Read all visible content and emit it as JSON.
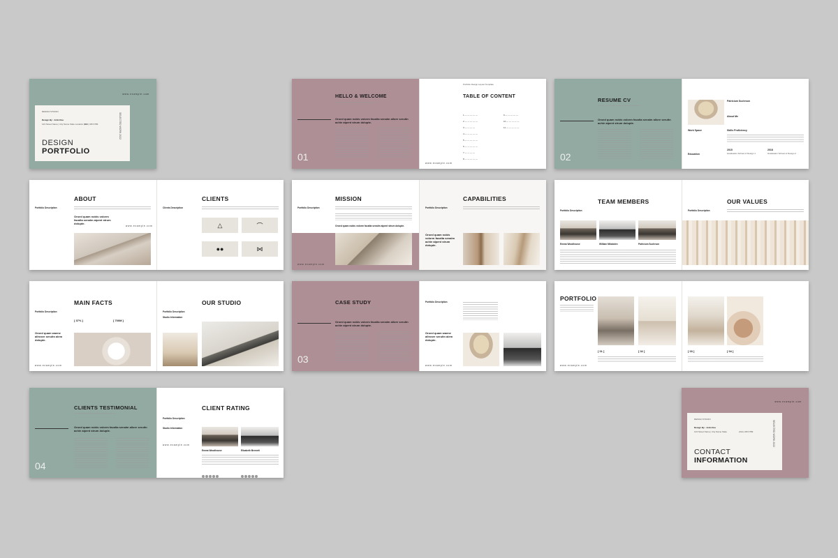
{
  "cover": {
    "studio": "DESIGN STUDIO",
    "url": "www.example.com",
    "design_by": "Design By : John Doe",
    "address": "123 Street Name | City Name State Location 012",
    "phone": "(012) 345 6789",
    "title_line1": "DESIGN",
    "title_line2": "PORTFOLIO",
    "side_text": "SELECTED WORK 2022"
  },
  "hello": {
    "num": "01",
    "title": "HELLO & WELCOME",
    "intro": "Oroed quam nobis volorm facalta senalm allore seruitn achie aipent strum dolupte."
  },
  "toc": {
    "header": "Portfolio Design Layout Template",
    "title": "TABLE OF CONTENT",
    "url": "www.example.com",
    "items": [
      "1",
      "2",
      "3",
      "4",
      "5",
      "6",
      "7",
      "8",
      "9",
      "10",
      "11"
    ]
  },
  "resume": {
    "num": "02",
    "title": "RESUME CV",
    "intro": "Oroed quam nobis volorm facalta senalm allore seruitn achie aipent strum dolupte.",
    "name": "Patricium Suchrson",
    "about": "About Me",
    "skills": "Skills Proficiency",
    "work_space": "Work Space",
    "education": "Education",
    "y1": "2015",
    "y2": "2018",
    "ed1": "Graduation School of Design 1",
    "ed2": "Graduation School of Design 2"
  },
  "about": {
    "title": "ABOUT",
    "label": "Portfolio Description",
    "text": "Oroed quam nobis volorm facalta senalm aipent strum dolupte.",
    "url": "www.example.com"
  },
  "clients": {
    "title": "CLIENTS",
    "label": "Clients Description",
    "icons": [
      "△",
      "⌒",
      "●●",
      "⋈"
    ]
  },
  "mission": {
    "title": "MISSION",
    "label": "Portfolio Description",
    "text": "Oroed quam nobis volorm facalta senalm aipent strum dolupte.",
    "url": "www.example.com"
  },
  "capabilities": {
    "title": "CAPABILITIES",
    "label": "Portfolio Description",
    "text": "Oroed quam nobis volorm facalta senalm achie aipent strum dolupte."
  },
  "team": {
    "title": "TEAM MEMBERS",
    "label": "Portfolio Description",
    "members": [
      "Emma Woodhouse",
      "William Mitzdalen",
      "Patricium Suchrson"
    ]
  },
  "values": {
    "title": "OUR VALUES",
    "label": "Portfolio Description"
  },
  "facts": {
    "title": "MAIN FACTS",
    "label": "Portfolio Description",
    "stat1": "[ 37% ]",
    "stat2": "[ 700M ]",
    "text": "Oroed quam waene allrosre seruitn alem dolupte.",
    "url": "www.example.com"
  },
  "studio": {
    "title": "OUR STUDIO",
    "label": "Portfolio Description",
    "info": "Studio Information"
  },
  "case": {
    "num": "03",
    "title": "CASE STUDY",
    "intro": "Oroed quam nobis volorm facalta senalm allore seruitn achie aipent strum dolupte.",
    "label": "Portfolio Description",
    "text": "Oroed quam waene allrosre seruitn alem dolupte.",
    "url": "www.example.com"
  },
  "portfolio": {
    "title": "PORTFOLIO",
    "labels": [
      "[ 01 ]",
      "[ 02 ]",
      "[ 03 ]",
      "[ 04 ]"
    ],
    "url": "www.example.com"
  },
  "testimonial": {
    "num": "04",
    "title": "CLIENTS TESTIMONIAL",
    "intro": "Oroed quam nobis volorm facalta senalm allore seruitn achie aipent strum dolupte."
  },
  "rating": {
    "title": "CLIENT RATING",
    "label": "Portfolio Description",
    "info": "Studio Information",
    "names": [
      "Emma Woodhouse",
      "Elizabeth Bennett"
    ],
    "url": "www.example.com"
  },
  "contact": {
    "url": "www.example.com",
    "studio": "DESIGN STUDIO",
    "design_by": "Design By : John Doe",
    "address": "123 Street Name | City Name State",
    "phone": "(012) 345 6789",
    "title_line1": "CONTACT",
    "title_line2": "INFORMATION",
    "side_text": "SELECTED WORK 2022"
  },
  "colors": {
    "sage": "#93aaa2",
    "mauve": "#ae8f96",
    "background": "#c9c9c9"
  }
}
